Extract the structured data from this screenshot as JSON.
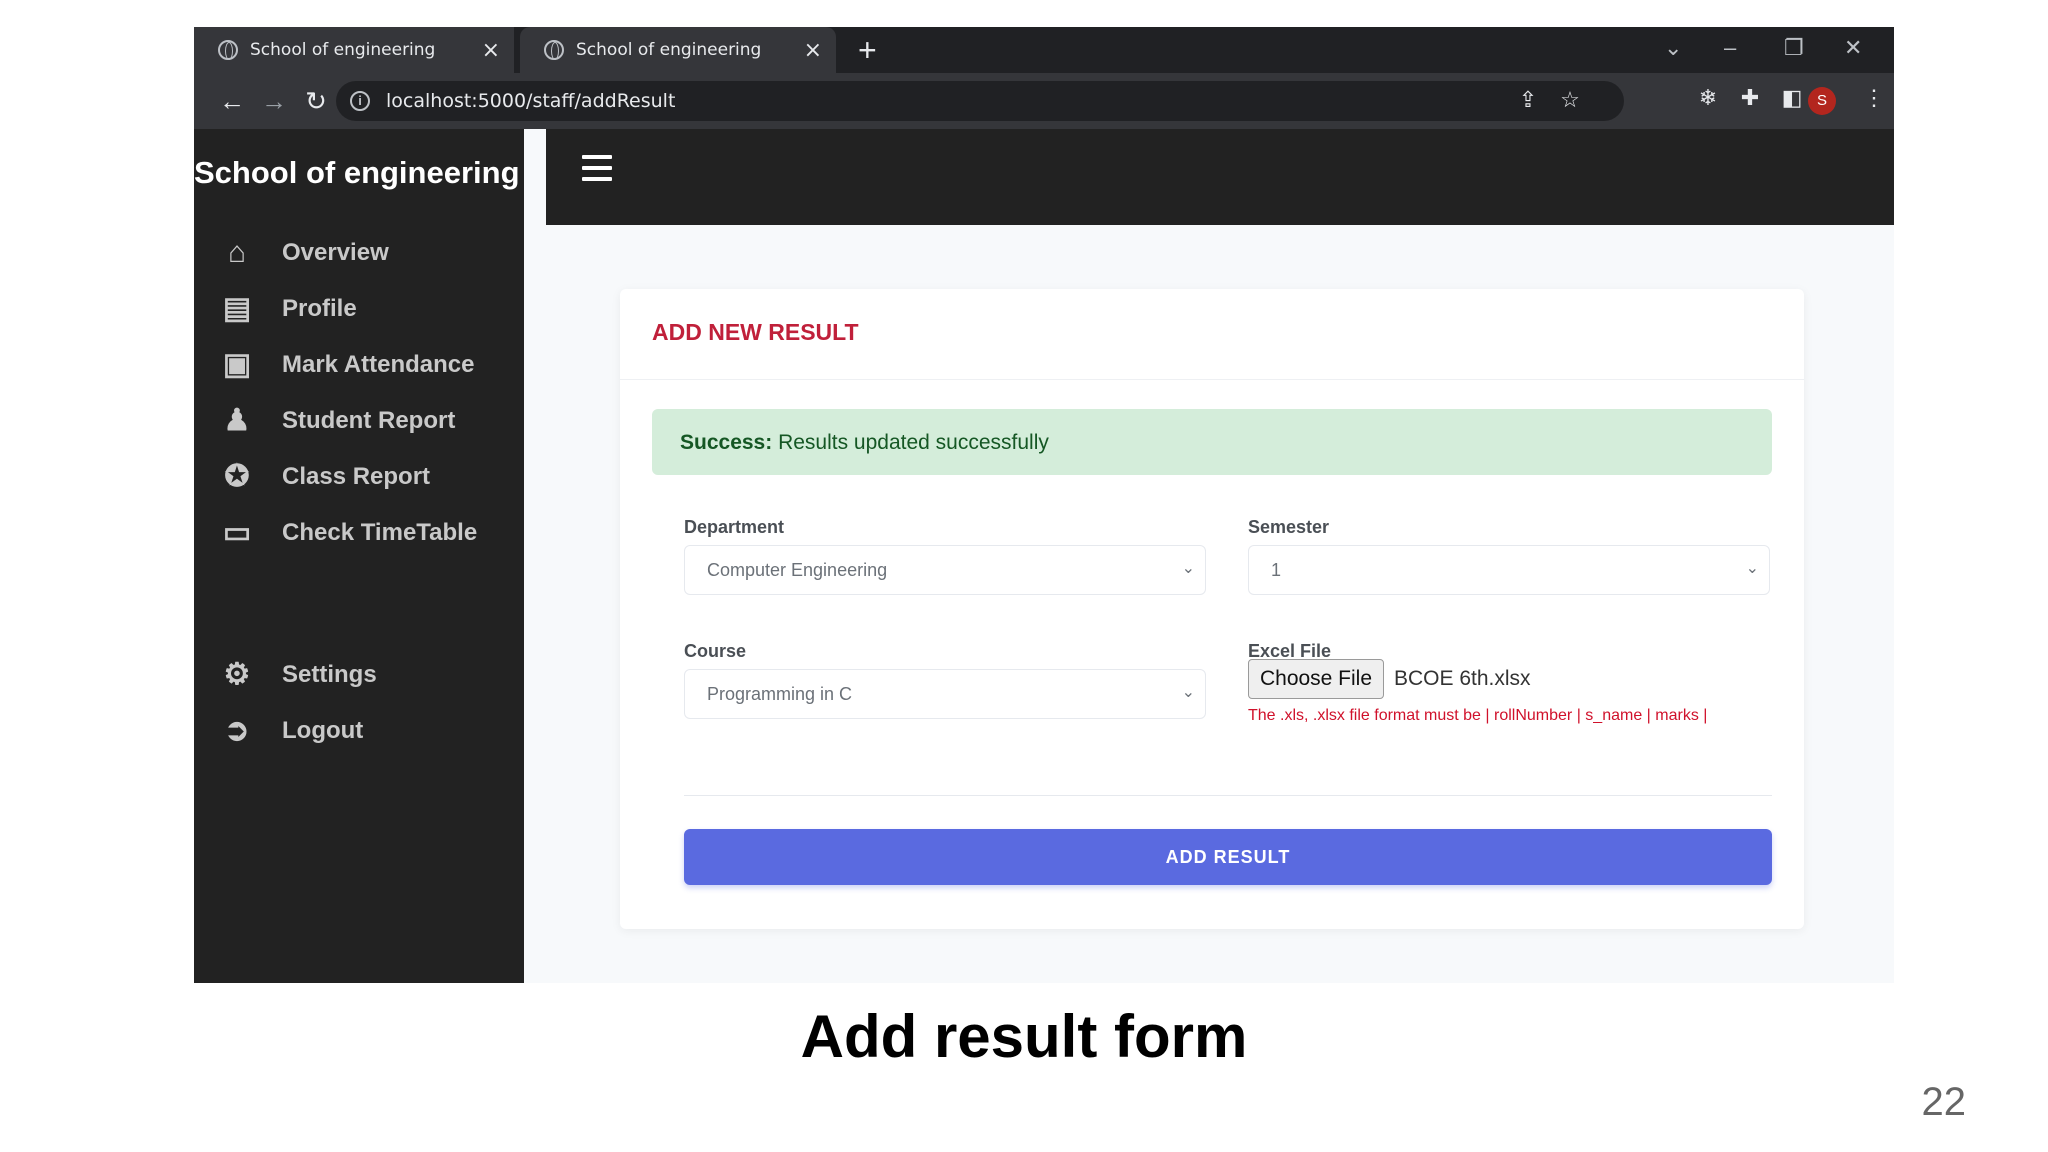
{
  "browser": {
    "tabs": [
      {
        "title": "School of engineering"
      },
      {
        "title": "School of engineering"
      }
    ],
    "url": "localhost:5000/staff/addResult",
    "profile_initial": "S"
  },
  "app": {
    "brand": "School of engineering",
    "nav": [
      {
        "label": "Overview",
        "icon": "home-icon"
      },
      {
        "label": "Profile",
        "icon": "id-card-icon"
      },
      {
        "label": "Mark Attendance",
        "icon": "chalkboard-teacher-icon"
      },
      {
        "label": "Student Report",
        "icon": "users-icon"
      },
      {
        "label": "Class Report",
        "icon": "award-icon"
      },
      {
        "label": "Check TimeTable",
        "icon": "laptop-icon"
      }
    ],
    "nav_bottom": [
      {
        "label": "Settings",
        "icon": "gear-icon"
      },
      {
        "label": "Logout",
        "icon": "logout-icon"
      }
    ]
  },
  "form": {
    "title": "ADD NEW RESULT",
    "alert": {
      "strong": "Success:",
      "message": " Results updated successfully"
    },
    "department": {
      "label": "Department",
      "value": "Computer Engineering"
    },
    "semester": {
      "label": "Semester",
      "value": "1"
    },
    "course": {
      "label": "Course",
      "value": "Programming in C"
    },
    "excel": {
      "label": "Excel File",
      "button": "Choose File",
      "file_name": "BCOE 6th.xlsx",
      "hint": "The .xls, .xlsx file format must be | rollNumber | s_name | marks |"
    },
    "submit_label": "ADD RESULT"
  },
  "slide": {
    "caption": "Add result form",
    "page_number": "22"
  }
}
